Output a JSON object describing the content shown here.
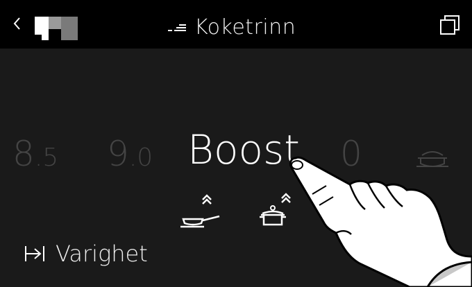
{
  "topbar": {
    "title": "Koketrinn",
    "back_icon": "chevron-left-icon",
    "logo_icon": "brand-logo",
    "title_icon": "heat-level-icon",
    "copy_icon": "window-copy-icon"
  },
  "levels": [
    {
      "major": "8",
      "minor": ".5",
      "selected": false
    },
    {
      "major": "9",
      "minor": ".0",
      "selected": false
    },
    {
      "major": "Boost",
      "minor": "",
      "selected": true
    },
    {
      "major": "0",
      "minor": "",
      "selected": false
    }
  ],
  "keep_warm_icon": "keep-warm-icon",
  "quick_modes": [
    {
      "icon": "pan-boost-icon"
    },
    {
      "icon": "pot-boost-icon"
    }
  ],
  "duration": {
    "label": "Varighet",
    "icon": "timer-end-icon"
  },
  "colors": {
    "background": "#1a1a1a",
    "topbar": "#000000",
    "active": "#ffffff",
    "inactive": "#444444"
  }
}
